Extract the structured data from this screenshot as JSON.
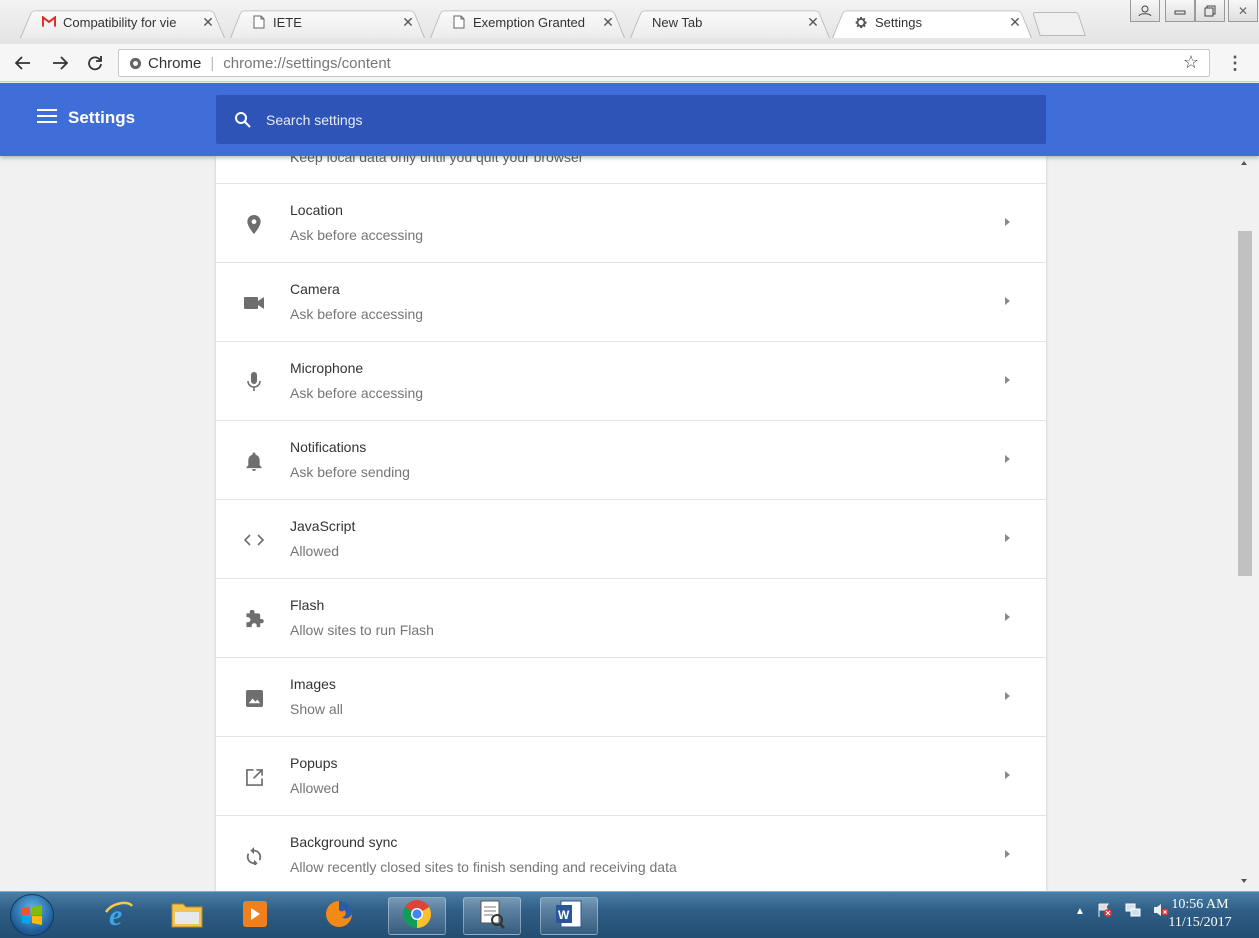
{
  "browser": {
    "tabs": [
      {
        "title": "Compatibility for vie",
        "icon": "gmail-icon",
        "active": false
      },
      {
        "title": "IETE",
        "icon": "page-icon",
        "active": false
      },
      {
        "title": "Exemption Granted",
        "icon": "page-icon",
        "active": false
      },
      {
        "title": "New Tab",
        "icon": "none",
        "active": false
      },
      {
        "title": "Settings",
        "icon": "gear-icon",
        "active": true
      }
    ],
    "address": {
      "site_label": "Chrome",
      "url": "chrome://settings/content"
    }
  },
  "settings": {
    "title": "Settings",
    "search_placeholder": "Search settings",
    "partial_text": "Keep local data only until you quit your browser",
    "items": [
      {
        "title": "Location",
        "subtitle": "Ask before accessing",
        "icon": "location-pin-icon"
      },
      {
        "title": "Camera",
        "subtitle": "Ask before accessing",
        "icon": "camera-icon"
      },
      {
        "title": "Microphone",
        "subtitle": "Ask before accessing",
        "icon": "microphone-icon"
      },
      {
        "title": "Notifications",
        "subtitle": "Ask before sending",
        "icon": "bell-icon"
      },
      {
        "title": "JavaScript",
        "subtitle": "Allowed",
        "icon": "code-brackets-icon"
      },
      {
        "title": "Flash",
        "subtitle": "Allow sites to run Flash",
        "icon": "puzzle-icon"
      },
      {
        "title": "Images",
        "subtitle": "Show all",
        "icon": "image-icon"
      },
      {
        "title": "Popups",
        "subtitle": "Allowed",
        "icon": "open-in-new-icon"
      },
      {
        "title": "Background sync",
        "subtitle": "Allow recently closed sites to finish sending and receiving data",
        "icon": "sync-icon"
      }
    ]
  },
  "taskbar": {
    "apps": [
      "internet-explorer-icon",
      "file-explorer-icon",
      "media-player-icon",
      "firefox-icon",
      "chrome-icon",
      "document-viewer-icon",
      "word-icon"
    ],
    "clock_time": "10:56 AM",
    "clock_date": "11/15/2017"
  },
  "colors": {
    "header": "#3f6ed8",
    "search_bar": "#2f54b8",
    "icon_gray": "#6e6e6e"
  }
}
